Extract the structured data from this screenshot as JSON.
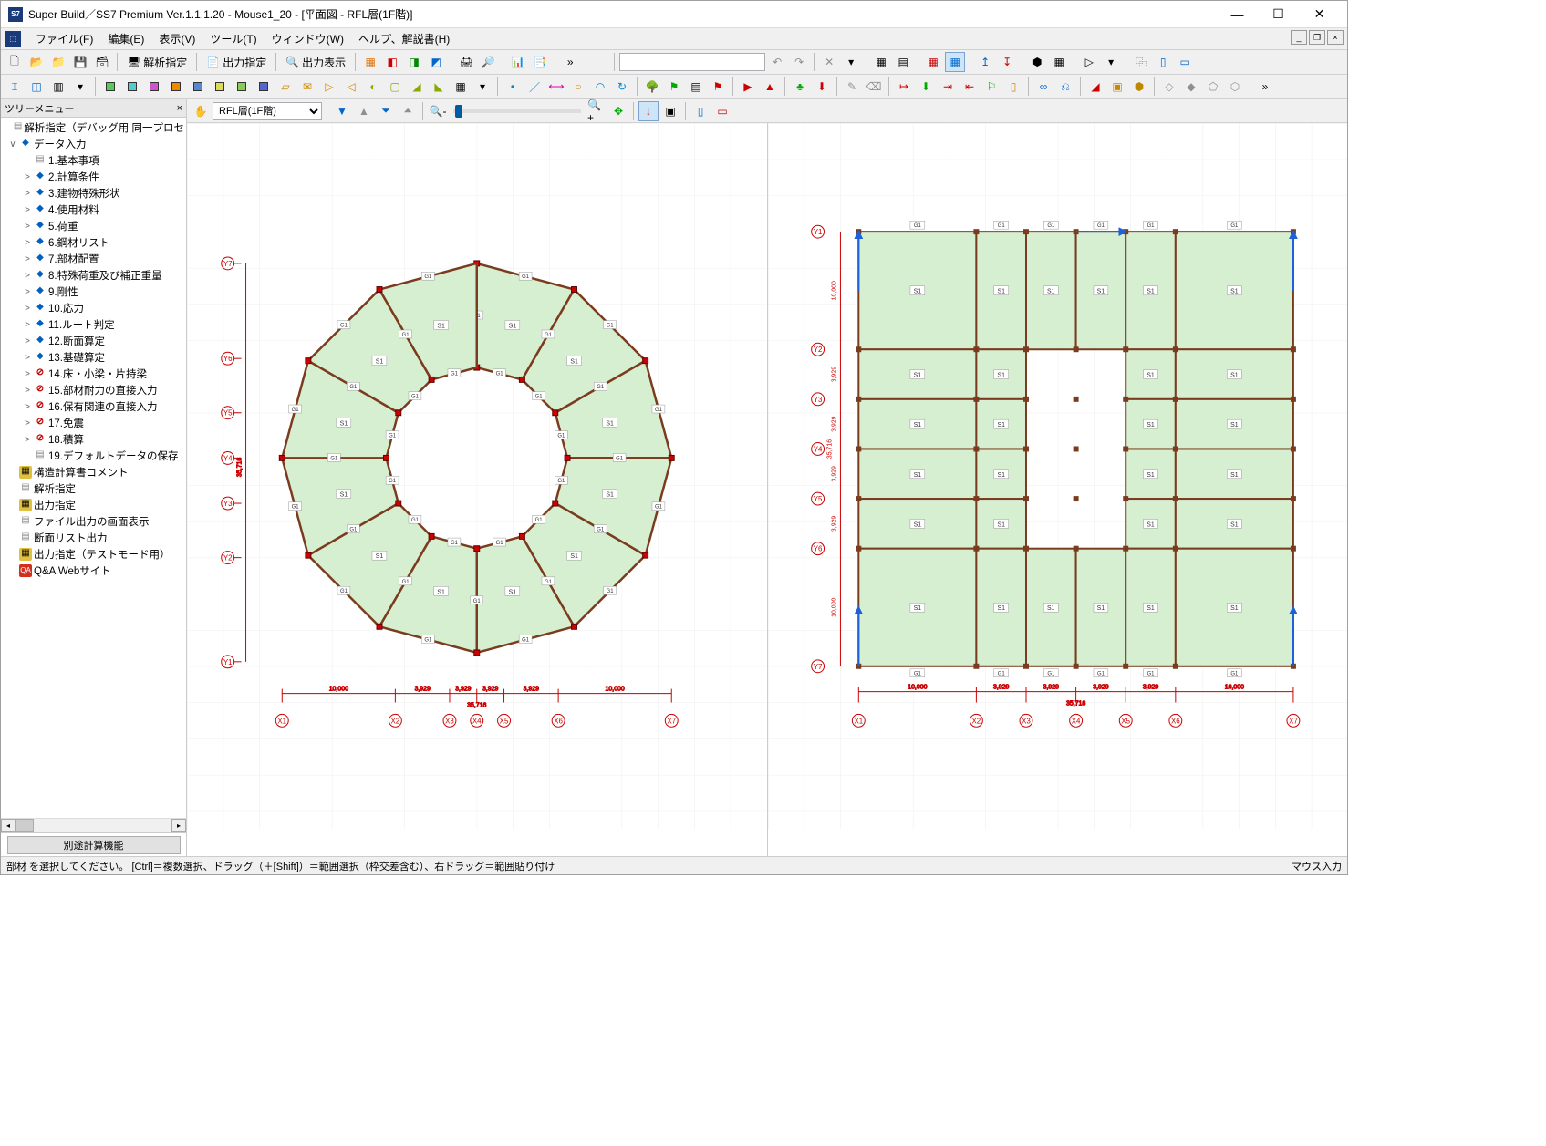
{
  "title": "Super Build／SS7 Premium  Ver.1.1.1.20 - Mouse1_20 - [平面図 - RFL層(1F階)]",
  "menus": [
    "ファイル(F)",
    "編集(E)",
    "表示(V)",
    "ツール(T)",
    "ウィンドウ(W)",
    "ヘルプ、解説書(H)"
  ],
  "toolbar1": {
    "analysis": "解析指定",
    "output_spec": "出力指定",
    "output_show": "出力表示"
  },
  "view_toolbar": {
    "layer_combo": "RFL層(1F階)"
  },
  "sidebar": {
    "header": "ツリーメニュー",
    "items": [
      {
        "indent": 0,
        "tw": "",
        "icon": "doc",
        "label": "解析指定（デバッグ用 同一プロセ"
      },
      {
        "indent": 0,
        "tw": "∨",
        "icon": "input",
        "label": "データ入力"
      },
      {
        "indent": 1,
        "tw": "",
        "icon": "doc",
        "label": "1.基本事項"
      },
      {
        "indent": 1,
        "tw": ">",
        "icon": "input",
        "label": "2.計算条件"
      },
      {
        "indent": 1,
        "tw": ">",
        "icon": "input",
        "label": "3.建物特殊形状"
      },
      {
        "indent": 1,
        "tw": ">",
        "icon": "input",
        "label": "4.使用材料"
      },
      {
        "indent": 1,
        "tw": ">",
        "icon": "input",
        "label": "5.荷重"
      },
      {
        "indent": 1,
        "tw": ">",
        "icon": "input",
        "label": "6.鋼材リスト"
      },
      {
        "indent": 1,
        "tw": ">",
        "icon": "input",
        "label": "7.部材配置"
      },
      {
        "indent": 1,
        "tw": ">",
        "icon": "input",
        "label": "8.特殊荷重及び補正重量"
      },
      {
        "indent": 1,
        "tw": ">",
        "icon": "input",
        "label": "9.剛性"
      },
      {
        "indent": 1,
        "tw": ">",
        "icon": "input",
        "label": "10.応力"
      },
      {
        "indent": 1,
        "tw": ">",
        "icon": "input",
        "label": "11.ルート判定"
      },
      {
        "indent": 1,
        "tw": ">",
        "icon": "input",
        "label": "12.断面算定"
      },
      {
        "indent": 1,
        "tw": ">",
        "icon": "input",
        "label": "13.基礎算定"
      },
      {
        "indent": 1,
        "tw": ">",
        "icon": "no",
        "label": "14.床・小梁・片持梁"
      },
      {
        "indent": 1,
        "tw": ">",
        "icon": "no",
        "label": "15.部材耐力の直接入力"
      },
      {
        "indent": 1,
        "tw": ">",
        "icon": "no",
        "label": "16.保有関連の直接入力"
      },
      {
        "indent": 1,
        "tw": ">",
        "icon": "no",
        "label": "17.免震"
      },
      {
        "indent": 1,
        "tw": ">",
        "icon": "no",
        "label": "18.積算"
      },
      {
        "indent": 1,
        "tw": "",
        "icon": "doc",
        "label": "19.デフォルトデータの保存"
      },
      {
        "indent": 0,
        "tw": "",
        "icon": "yellow",
        "label": "構造計算書コメント"
      },
      {
        "indent": 0,
        "tw": "",
        "icon": "doc",
        "label": "解析指定"
      },
      {
        "indent": 0,
        "tw": "",
        "icon": "yellow",
        "label": "出力指定"
      },
      {
        "indent": 0,
        "tw": "",
        "icon": "doc",
        "label": "ファイル出力の画面表示"
      },
      {
        "indent": 0,
        "tw": "",
        "icon": "doc",
        "label": "断面リスト出力"
      },
      {
        "indent": 0,
        "tw": "",
        "icon": "yellow",
        "label": "出力指定（テストモード用）"
      },
      {
        "indent": 0,
        "tw": "",
        "icon": "red",
        "label": "Q&A Webサイト"
      }
    ],
    "button": "別途計算機能"
  },
  "plan_left": {
    "y_axes": [
      "Y7",
      "Y6",
      "Y5",
      "Y4",
      "Y3",
      "Y2",
      "Y1"
    ],
    "x_axes": [
      "X1",
      "X2",
      "X3",
      "X4",
      "X5",
      "X6",
      "X7"
    ],
    "x_dims": [
      "10,000",
      "3,929",
      "3,929",
      "3,929",
      "3,929",
      "10,000"
    ],
    "x_total": "35,716",
    "y_total": "35,716",
    "slab_label": "S1",
    "beam_label_h": "G1",
    "beam_label_v": "G1"
  },
  "plan_right": {
    "y_axes": [
      "Y7",
      "Y6",
      "Y5",
      "Y4",
      "Y3",
      "Y2",
      "Y1"
    ],
    "x_axes": [
      "X1",
      "X2",
      "X3",
      "X4",
      "X5",
      "X6",
      "X7"
    ],
    "x_dims": [
      "10,000",
      "3,929",
      "3,929",
      "3,929",
      "3,929",
      "10,000"
    ],
    "x_total": "35,716",
    "y_dims_top_to_bottom": [
      "10,000",
      "3,929",
      "3,929",
      "3,929",
      "3,929",
      "10,000"
    ],
    "y_total": "35,716",
    "slab_label": "S1",
    "beam_label": "G1"
  },
  "status": {
    "left": "部材 を選択してください。 [Ctrl]＝複数選択、ドラッグ（＋[Shift]）＝範囲選択（枠交差含む）、右ドラッグ＝範囲貼り付け",
    "right": "マウス入力"
  }
}
